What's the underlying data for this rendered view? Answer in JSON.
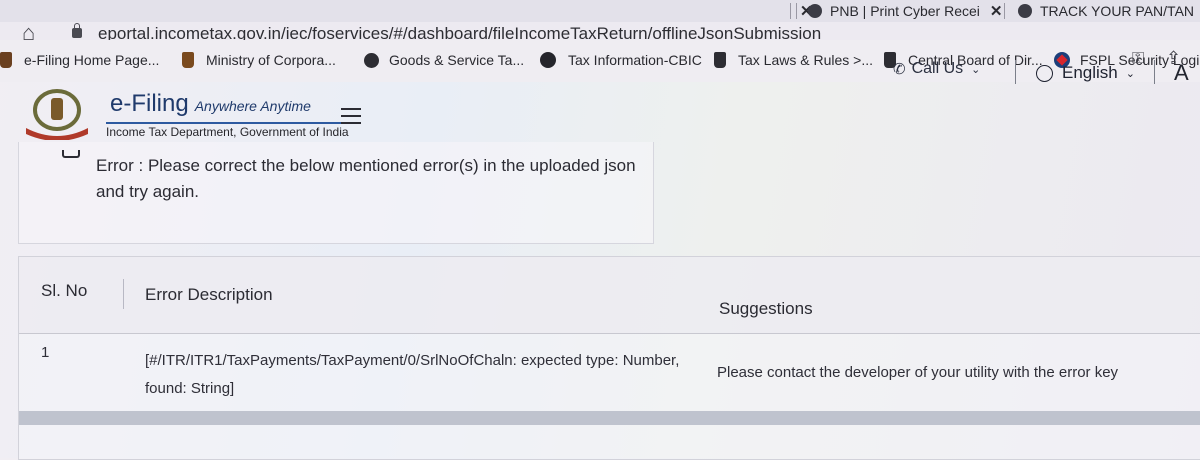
{
  "browser": {
    "tabs": [
      {
        "label": "PNB | Print Cyber Recei"
      },
      {
        "label": "TRACK YOUR PAN/TAN"
      }
    ],
    "url": "eportal.incometax.gov.in/iec/foservices/#/dashboard/fileIncomeTaxReturn/offlineJsonSubmission",
    "bookmarks": [
      {
        "label": "e-Filing Home Page..."
      },
      {
        "label": "Ministry of Corpora..."
      },
      {
        "label": "Goods & Service Ta..."
      },
      {
        "label": "Tax Information-CBIC"
      },
      {
        "label": "Tax Laws & Rules >..."
      },
      {
        "label": "Central Board of Dir..."
      },
      {
        "label": "FSPL Security Login"
      }
    ]
  },
  "header": {
    "brand": "e-Filing",
    "tagline": "Anywhere Anytime",
    "subtitle": "Income Tax Department, Government of India",
    "call_us": "Call Us",
    "language": "English",
    "font_size_label": "A"
  },
  "error": {
    "message": "Error : Please correct the below mentioned error(s) in the uploaded json and try again."
  },
  "table": {
    "headers": [
      "Sl. No",
      "Error Description",
      "Suggestions"
    ],
    "rows": [
      {
        "sl_no": "1",
        "description": "[#/ITR/ITR1/TaxPayments/TaxPayment/0/SrlNoOfChaln: expected type: Number, found: String]",
        "suggestion": "Please contact the developer of your utility with the error key"
      }
    ]
  },
  "colors": {
    "brand_blue": "#1f3a6b",
    "accent_blue": "#2d5aa0"
  }
}
